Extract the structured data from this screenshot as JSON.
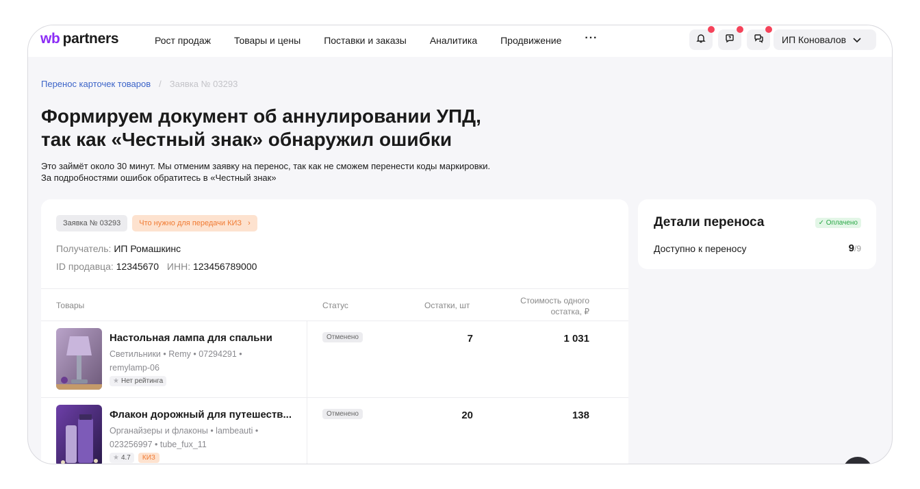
{
  "header": {
    "logo_wb": "wb",
    "logo_partners": "partners",
    "nav": [
      "Рост продаж",
      "Товары и цены",
      "Поставки и заказы",
      "Аналитика",
      "Продвижение"
    ],
    "more": "···",
    "icons": [
      "bell-icon",
      "help-chat-icon",
      "messages-icon"
    ],
    "user": "ИП Коноваловnexpand"
  },
  "breadcrumb": {
    "link": "Перенос карточек товаров",
    "separator": "/",
    "current": "Заявка № 03293"
  },
  "title_line1": "Формируем документ об аннулировании УПД,",
  "title_line2": "так как «Честный знак» обнаружил ошибки",
  "subtitle_line1": "Это займёт около 30 минут. Мы отменим заявку на перенос, так как не сможем перенести коды маркировки.",
  "subtitle_line2": "За подробностями ошибок обратитесь в «Честный знак»",
  "request": {
    "number_tag": "Заявка № 03293",
    "kiz_link": "Что нужно для передачи КИЗ",
    "recipient_label": "Получатель:",
    "recipient_value": "ИП Ромашкинс",
    "seller_id_label": "ID продавца:",
    "seller_id_value": "12345670",
    "inn_label": "ИНН:",
    "inn_value": "123456789000"
  },
  "table": {
    "headers": {
      "products": "Товары",
      "status": "Статус",
      "stock": "Остатки, шт",
      "cost_line1": "Стоимость одного",
      "cost_line2": "остатка, ₽"
    },
    "rows": [
      {
        "name": "Настольная лампа для спальни",
        "meta_line1": "Светильники • Remy • 07294291 •",
        "meta_line2": "remylamp-06",
        "rating": "Нет рейтинга",
        "kiz": "",
        "status": "Отменено",
        "stock": "7",
        "cost": "1 031"
      },
      {
        "name": "Флакон дорожный для путешеств...",
        "meta_line1": "Органайзеры и флаконы • lambeauti •",
        "meta_line2": "023256997 • tube_fux_11",
        "rating": "4.7",
        "kiz": "КИЗ",
        "status": "Отменено",
        "stock": "20",
        "cost": "138"
      }
    ]
  },
  "side": {
    "title": "Детали переноса",
    "paid": "✓ Оплачено",
    "available_label": "Доступно к переносу",
    "available_value": "9",
    "available_total": "/9"
  },
  "colors": {
    "brand": "#8b2cf5",
    "link": "#3c64c8",
    "orange": "#f07a32",
    "notification_dot": "#f5435a",
    "success": "#28a745"
  }
}
